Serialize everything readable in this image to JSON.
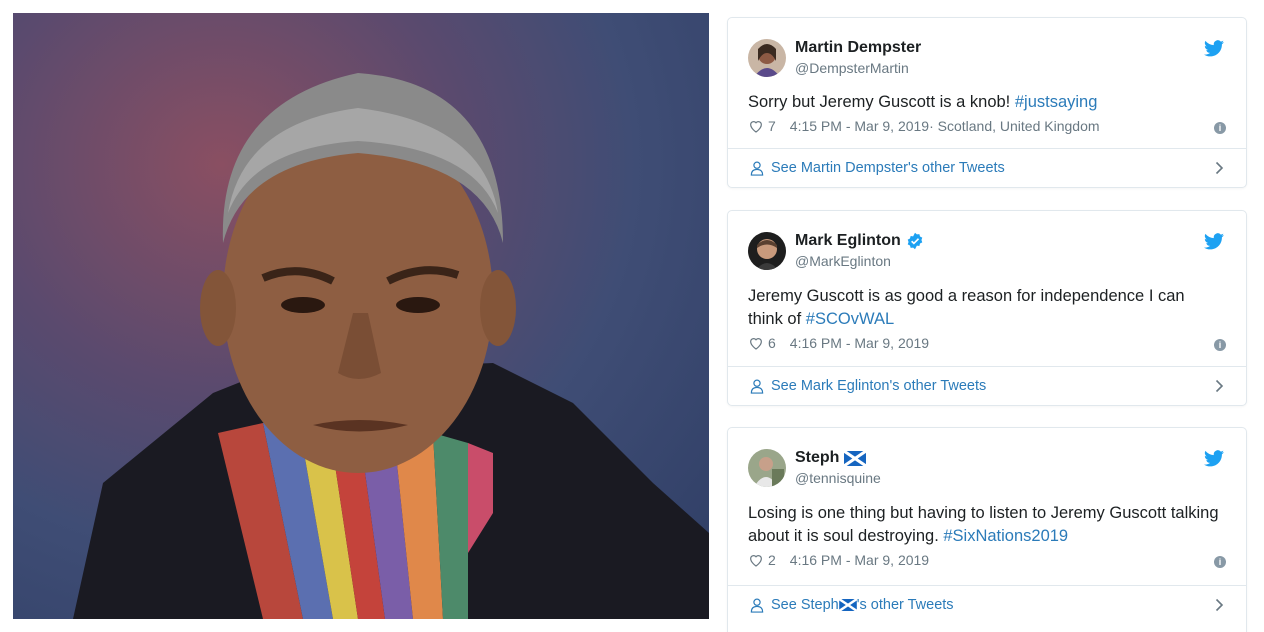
{
  "photo": {
    "alt": ""
  },
  "tweets": [
    {
      "name": "Martin Dempster",
      "handle": "@DempsterMartin",
      "verified": false,
      "flag": false,
      "text_parts": [
        "Sorry but Jeremy Guscott is a knob! ",
        "#justsaying"
      ],
      "likes": "7",
      "time": "4:15 PM - Mar 9, 2019",
      "location": " · Scotland, United Kingdom",
      "footer": "See Martin Dempster's other Tweets"
    },
    {
      "name": "Mark Eglinton",
      "handle": "@MarkEglinton",
      "verified": true,
      "flag": false,
      "text_parts": [
        "Jeremy Guscott is as good a reason for independence I can think of ",
        "#SCOvWAL"
      ],
      "likes": "6",
      "time": "4:16 PM - Mar 9, 2019",
      "location": "",
      "footer": "See Mark Eglinton's other Tweets"
    },
    {
      "name": "Steph",
      "handle": "@tennisquine",
      "verified": false,
      "flag": true,
      "text_parts": [
        "Losing is one thing but having to listen to Jeremy Guscott talking about it is soul destroying. ",
        "#SixNations2019"
      ],
      "likes": "2",
      "time": "4:16 PM - Mar 9, 2019",
      "location": "",
      "footer_prefix": "See Steph ",
      "footer_suffix": "'s other Tweets"
    }
  ],
  "colors": {
    "link": "#2b7bb9",
    "twitter_blue": "#1da1f2",
    "muted": "#697882"
  }
}
